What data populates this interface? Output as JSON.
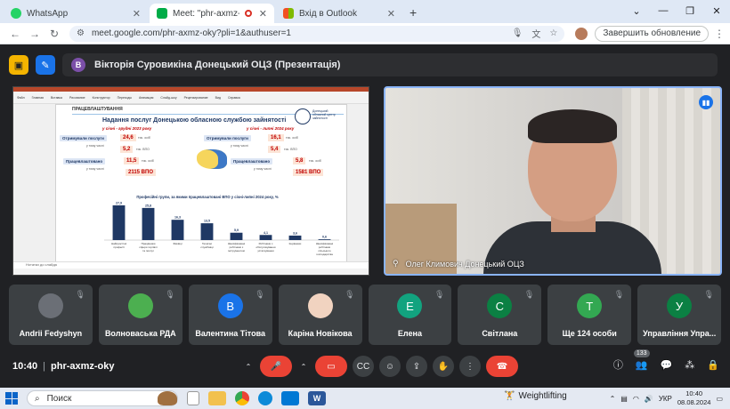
{
  "browser": {
    "tabs": [
      {
        "title": "WhatsApp",
        "icon": "whatsapp-icon",
        "color": "#25d366",
        "active": false
      },
      {
        "title": "Meet: \"phr-axmz-oky\"",
        "icon": "meet-icon",
        "color": "#00ac47",
        "active": true
      },
      {
        "title": "Вхід в Outlook",
        "icon": "microsoft-icon",
        "color": "#f25022",
        "active": false
      }
    ],
    "new_tab": "+",
    "window_controls": [
      "⌄",
      "—",
      "❐",
      "✕"
    ],
    "url": "meet.google.com/phr-axmz-oky?pli=1&authuser=1",
    "update_label": "Завершить обновление"
  },
  "meet": {
    "presenter_bar": {
      "avatar_letter": "В",
      "text": "Вікторія Суровикіна Донецький ОЦЗ (Презентація)"
    },
    "presentation": {
      "ribbon": [
        "Файл",
        "Главная",
        "Вставка",
        "Рисование",
        "Конструктор",
        "Переходы",
        "Анимация",
        "Слайд-шоу",
        "Рецензирование",
        "Вид",
        "Справка"
      ],
      "slide_header": "ПРАЦЕВЛАШТУВАННЯ",
      "slide_title": "Надання послуг Донецькою обласною службою зайнятості",
      "org_name": "Донецький обласний центр зайнятості",
      "left": {
        "period": "у січні - грудні 2023 року",
        "received_label": "Отримували послуги",
        "received_value": "24,6",
        "received_unit": "тис. осіб",
        "incl_1": "у тому числі",
        "vpo_value": "5,2",
        "vpo_unit": "тис. ВПО",
        "employed_label": "Працевлаштовано",
        "employed_value": "11,5",
        "employed_unit": "тис. осіб",
        "incl_2": "у тому числі",
        "employed_vpo": "2115 ВПО"
      },
      "right": {
        "period": "у січні - липні 2024 року",
        "received_label": "Отримували послуги",
        "received_value": "16,1",
        "received_unit": "тис. осіб",
        "incl_1": "у тому числі",
        "vpo_value": "5,4",
        "vpo_unit": "тис. ВПО",
        "employed_label": "Працевлаштовано",
        "employed_value": "5,8",
        "employed_unit": "тис. осіб",
        "incl_2": "у тому числі",
        "employed_vpo": "1581 ВПО"
      },
      "notes": "Нотатки до слайда"
    },
    "camera": {
      "name": "Олег Климович Донецький ОЦЗ"
    },
    "participants": [
      {
        "name": "Andrii Fedyshyn",
        "avatar_letter": "",
        "color": "#6b6f76",
        "kind": "map"
      },
      {
        "name": "Волноваська РДА",
        "avatar_letter": "",
        "color": "#4caf50",
        "kind": "emblem"
      },
      {
        "name": "Валентина Тітова",
        "avatar_letter": "В",
        "color": "#1a73e8",
        "kind": "letter"
      },
      {
        "name": "Каріна Новікова",
        "avatar_letter": "",
        "color": "#f1d3c0",
        "kind": "photo"
      },
      {
        "name": "Елена",
        "avatar_letter": "Е",
        "color": "#12a37f",
        "kind": "letter"
      },
      {
        "name": "Світлана",
        "avatar_letter": "С",
        "color": "#0b8043",
        "kind": "letter"
      },
      {
        "name": "Ще 124 особи",
        "avatar_letter": "Т",
        "color": "#33a852",
        "kind": "more"
      },
      {
        "name": "Управління Упра...",
        "avatar_letter": "У",
        "color": "#0b8043",
        "kind": "letter"
      }
    ],
    "bottom": {
      "time": "10:40",
      "separator": "|",
      "meeting_code": "phr-axmz-oky",
      "people_count": "133"
    }
  },
  "chart_data": {
    "type": "bar",
    "title": "Професійні групи, за якими працевлаштовані ВПО у січні-липні 2024 року, %",
    "categories": [
      "Найпростіші професії",
      "Працівники сфери торгівлі та послуг",
      "Фахівці",
      "Технічні службовці",
      "Кваліфіковані робітники з інструментом",
      "Робітники з обслуговування устаткування",
      "Керівники",
      "Кваліфіковані робітники сільського господарства"
    ],
    "values": [
      27.9,
      25.8,
      16.3,
      13.5,
      5.9,
      4.1,
      3.6,
      0.6
    ],
    "ylim": [
      0,
      30
    ],
    "value_labels": [
      "27,9",
      "25,8",
      "16,3",
      "13,5",
      "5,9",
      "4,1",
      "3,6",
      "0,6"
    ],
    "bar_color": "#1f3864"
  },
  "taskbar": {
    "search_placeholder": "Поиск",
    "weather": "Weightlifting",
    "lang": "УКР",
    "time": "10:40",
    "date": "08.08.2024"
  }
}
